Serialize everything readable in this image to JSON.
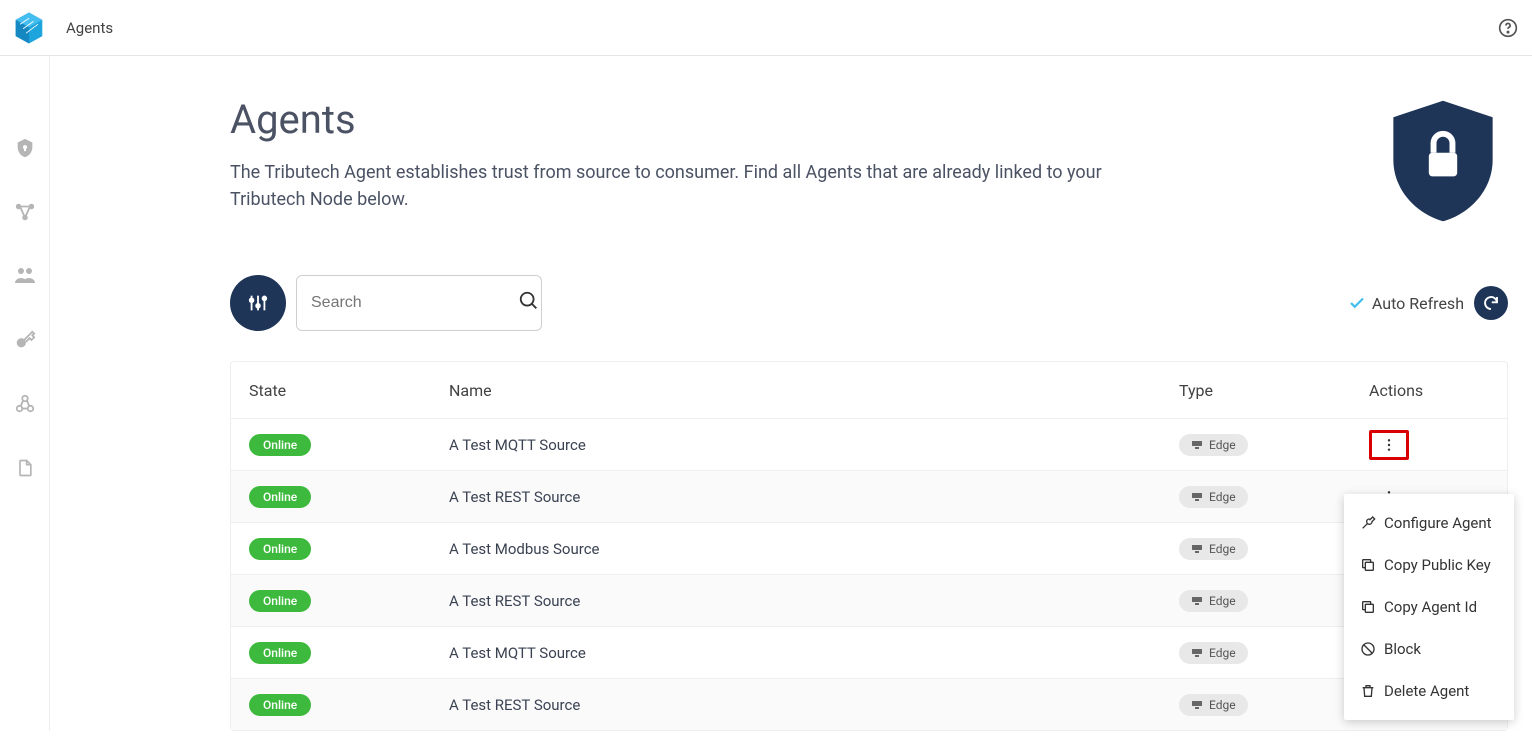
{
  "header": {
    "breadcrumb": "Agents"
  },
  "page": {
    "title": "Agents",
    "description": "The Tributech Agent establishes trust from source to consumer. Find all Agents that are already linked to your Tributech Node below."
  },
  "search": {
    "placeholder": "Search"
  },
  "controls": {
    "auto_refresh_label": "Auto Refresh"
  },
  "table": {
    "headers": {
      "state": "State",
      "name": "Name",
      "type": "Type",
      "actions": "Actions"
    },
    "rows": [
      {
        "state": "Online",
        "name": "A Test MQTT Source",
        "type": "Edge"
      },
      {
        "state": "Online",
        "name": "A Test REST Source",
        "type": "Edge"
      },
      {
        "state": "Online",
        "name": "A Test Modbus Source",
        "type": "Edge"
      },
      {
        "state": "Online",
        "name": "A Test REST Source",
        "type": "Edge"
      },
      {
        "state": "Online",
        "name": "A Test MQTT Source",
        "type": "Edge"
      },
      {
        "state": "Online",
        "name": "A Test REST Source",
        "type": "Edge"
      }
    ]
  },
  "menu": {
    "items": [
      "Configure Agent",
      "Copy Public Key",
      "Copy Agent Id",
      "Block",
      "Delete Agent"
    ]
  }
}
